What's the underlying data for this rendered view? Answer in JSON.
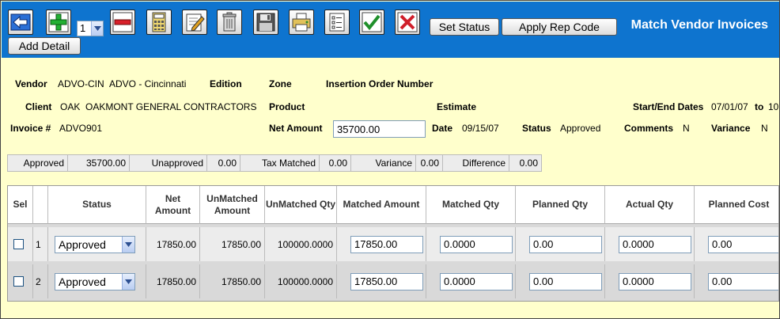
{
  "toolbar": {
    "qty_value": "1",
    "set_status_label": "Set Status",
    "apply_rep_code_label": "Apply Rep Code",
    "add_detail_label": "Add Detail",
    "title": "Match Vendor Invoices"
  },
  "header": {
    "vendor_label": "Vendor",
    "vendor_code": "ADVO-CIN",
    "vendor_name": "ADVO - Cincinnati",
    "edition_label": "Edition",
    "zone_label": "Zone",
    "ion_label": "Insertion Order Number",
    "client_label": "Client",
    "client_code": "OAK",
    "client_name": "OAKMONT GENERAL CONTRACTORS",
    "product_label": "Product",
    "estimate_label": "Estimate",
    "start_end_label": "Start/End Dates",
    "start_date": "07/01/07",
    "to_label": "to",
    "end_date_partial": "10",
    "invoice_label": "Invoice #",
    "invoice_value": "ADVO901",
    "net_amount_label": "Net Amount",
    "net_amount_value": "35700.00",
    "date_label": "Date",
    "date_value": "09/15/07",
    "status_label": "Status",
    "status_value": "Approved",
    "comments_label": "Comments",
    "comments_value": "N",
    "variance_label": "Variance",
    "variance_value": "N"
  },
  "summary": [
    {
      "label": "Approved",
      "value": "35700.00"
    },
    {
      "label": "Unapproved",
      "value": "0.00"
    },
    {
      "label": "Tax Matched",
      "value": "0.00"
    },
    {
      "label": "Variance",
      "value": "0.00"
    },
    {
      "label": "Difference",
      "value": "0.00"
    }
  ],
  "grid": {
    "columns": [
      "Sel",
      "",
      "Status",
      "Net Amount",
      "UnMatched Amount",
      "UnMatched Qty",
      "Matched Amount",
      "Matched Qty",
      "Planned Qty",
      "Actual Qty",
      "Planned Cost"
    ],
    "rows": [
      {
        "num": "1",
        "status": "Approved",
        "net_amount": "17850.00",
        "unmatched_amount": "17850.00",
        "unmatched_qty": "100000.0000",
        "matched_amount": "17850.00",
        "matched_qty": "0.0000",
        "planned_qty": "0.00",
        "actual_qty": "0.0000",
        "planned_cost": "0.00"
      },
      {
        "num": "2",
        "status": "Approved",
        "net_amount": "17850.00",
        "unmatched_amount": "17850.00",
        "unmatched_qty": "100000.0000",
        "matched_amount": "17850.00",
        "matched_qty": "0.0000",
        "planned_qty": "0.00",
        "actual_qty": "0.0000",
        "planned_cost": "0.00"
      }
    ]
  },
  "colors": {
    "toolbar_bg": "#0e74cf",
    "page_bg": "#ffffcc",
    "alt_row": "#d9d9d9"
  }
}
